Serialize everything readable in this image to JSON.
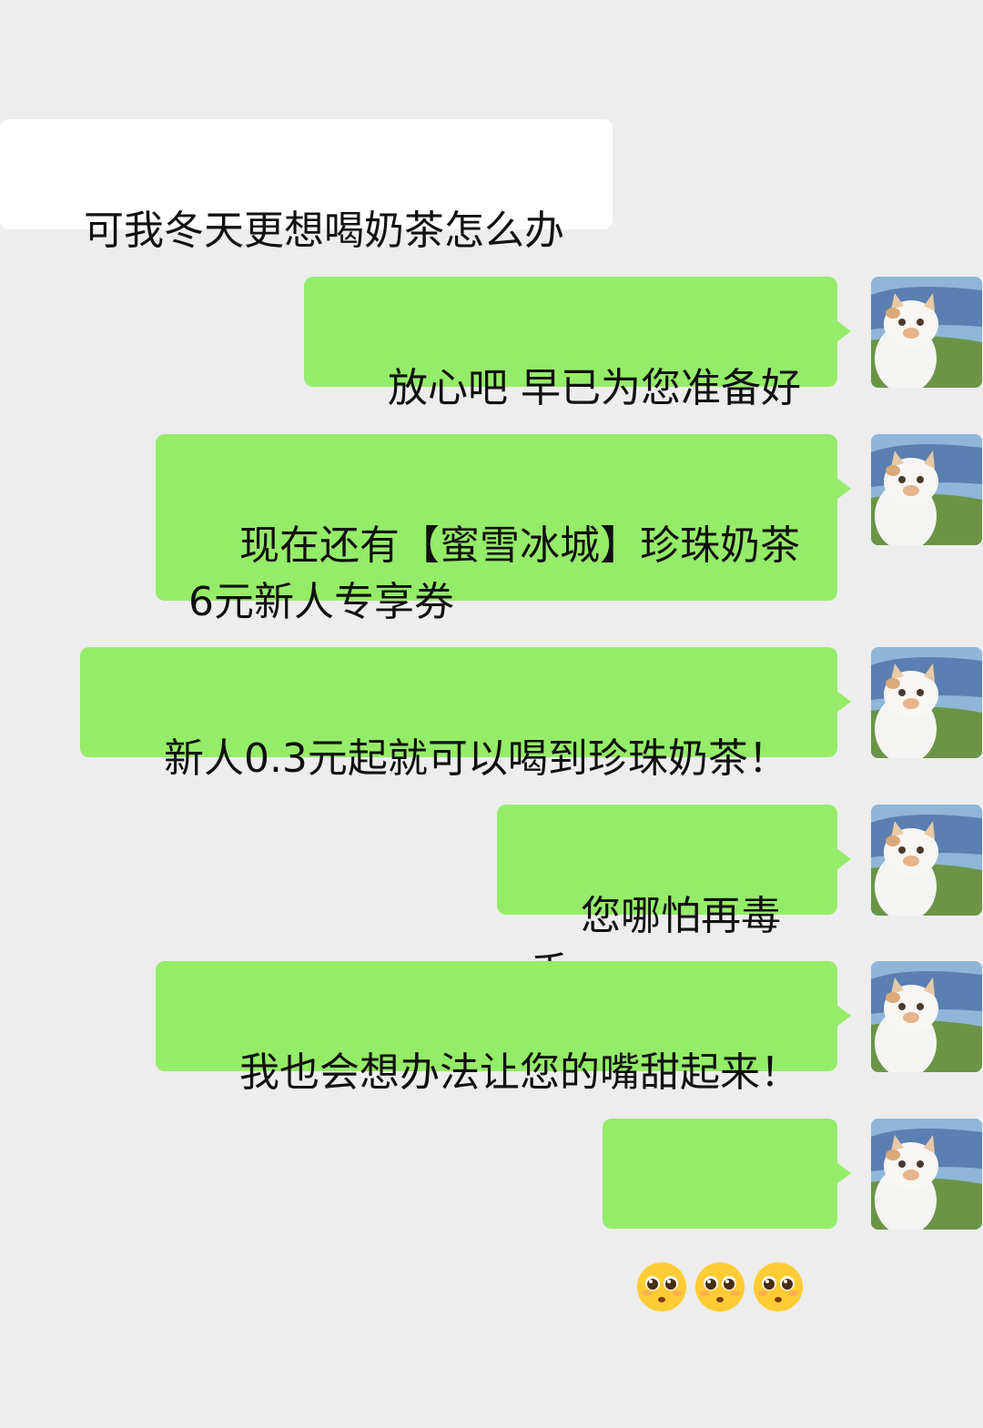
{
  "chat": {
    "messages": [
      {
        "side": "in",
        "text": "可我冬天更想喝奶茶怎么办"
      },
      {
        "side": "out",
        "text": "放心吧 早已为您准备好"
      },
      {
        "side": "out",
        "text": "现在还有【蜜雪冰城】珍珠奶茶\n6元新人专享券"
      },
      {
        "side": "out",
        "text": "新人0.3元起就可以喝到珍珠奶茶！"
      },
      {
        "side": "out",
        "text": "您哪怕再毒舌"
      },
      {
        "side": "out",
        "text": "我也会想办法让您的嘴甜起来！"
      },
      {
        "side": "out",
        "emoji": [
          "pleading-face-emoji",
          "pleading-face-emoji",
          "pleading-face-emoji"
        ]
      }
    ],
    "avatar_icon": "cat-avatar-icon",
    "colors": {
      "background": "#ededed",
      "outgoing_bubble": "#95ec69",
      "incoming_bubble": "#ffffff",
      "text": "#111111"
    }
  }
}
